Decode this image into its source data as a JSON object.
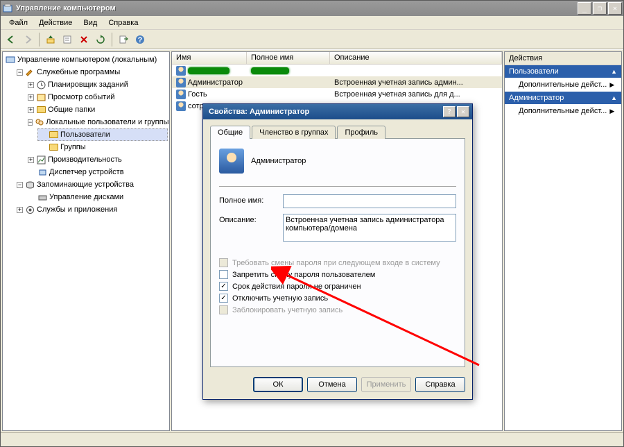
{
  "window": {
    "title": "Управление компьютером",
    "minimize": "_",
    "restore": "❐",
    "close": "✕"
  },
  "menu": {
    "file": "Файл",
    "action": "Действие",
    "view": "Вид",
    "help": "Справка"
  },
  "tree": {
    "root": "Управление компьютером (локальным)",
    "system_tools": "Служебные программы",
    "task_scheduler": "Планировщик заданий",
    "event_viewer": "Просмотр событий",
    "shared_folders": "Общие папки",
    "local_users_groups": "Локальные пользователи и группы",
    "users": "Пользователи",
    "groups": "Группы",
    "performance": "Производительность",
    "device_manager": "Диспетчер устройств",
    "storage": "Запоминающие устройства",
    "disk_mgmt": "Управление дисками",
    "services_apps": "Службы и приложения"
  },
  "list": {
    "col_name": "Имя",
    "col_fullname": "Полное имя",
    "col_desc": "Описание",
    "rows": [
      {
        "name": "",
        "fullname": "",
        "desc": "",
        "redacted": true
      },
      {
        "name": "Администратор",
        "fullname": "",
        "desc": "Встроенная учетная запись админ...",
        "selected": true
      },
      {
        "name": "Гость",
        "fullname": "",
        "desc": "Встроенная учетная запись для д..."
      },
      {
        "name": "сотрудник",
        "fullname": "",
        "desc": ""
      }
    ]
  },
  "actions": {
    "title": "Действия",
    "section1": "Пользователи",
    "more1": "Дополнительные дейст...",
    "section2": "Администратор",
    "more2": "Дополнительные дейст..."
  },
  "dialog": {
    "title": "Свойства: Администратор",
    "help": "?",
    "close": "✕",
    "tabs": {
      "general": "Общие",
      "membership": "Членство в группах",
      "profile": "Профиль"
    },
    "user_label": "Администратор",
    "field_fullname": "Полное имя:",
    "value_fullname": "",
    "field_desc": "Описание:",
    "value_desc": "Встроенная учетная запись администратора компьютера/домена",
    "chk_must_change": "Требовать смены пароля при следующем входе в систему",
    "chk_cannot_change": "Запретить смену пароля пользователем",
    "chk_never_expires": "Срок действия пароля не ограничен",
    "chk_disable": "Отключить учетную запись",
    "chk_locked": "Заблокировать учетную запись",
    "btn_ok": "ОК",
    "btn_cancel": "Отмена",
    "btn_apply": "Применить",
    "btn_help": "Справка"
  }
}
